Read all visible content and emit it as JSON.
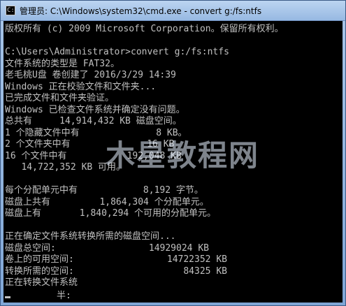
{
  "window": {
    "title": "管理员: C:\\Windows\\system32\\cmd.exe - convert  g:/fs:ntfs",
    "icon": "cmd-icon"
  },
  "console": {
    "lines": [
      "版权所有 (c) 2009 Microsoft Corporation。保留所有权利。",
      "",
      "C:\\Users\\Administrator>convert g:/fs:ntfs",
      "文件系统的类型是 FAT32。",
      "老毛桃U盘 卷创建了 2016/3/29 14:39",
      "Windows 正在校验文件和文件夹...",
      "已完成文件和文件夹验证。",
      "Windows 已检查文件系统并确定没有问题。",
      "总共有     14,914,432 KB 磁盘空间。",
      "1 个隐藏文件中有              8 KB。",
      "2 个文件夹中有              16 KB",
      "16 个文件中有           192,048 KB",
      "   14,722,352 KB 可用。",
      "",
      "每个分配单元中有            8,192 字节。",
      "磁盘上共有         1,864,304 个分配单元。",
      "磁盘上有       1,840,294 个可用的分配单元。",
      "",
      "正在确定文件系统转换所需的磁盘空间...",
      "磁盘总空间:                 14929024 KB",
      "卷上的可用空间:                 14722352 KB",
      "转换所需的空间:                    84325 KB",
      "正在转换文件系统"
    ],
    "progress_text": "半:"
  },
  "watermark": "木星教程网"
}
